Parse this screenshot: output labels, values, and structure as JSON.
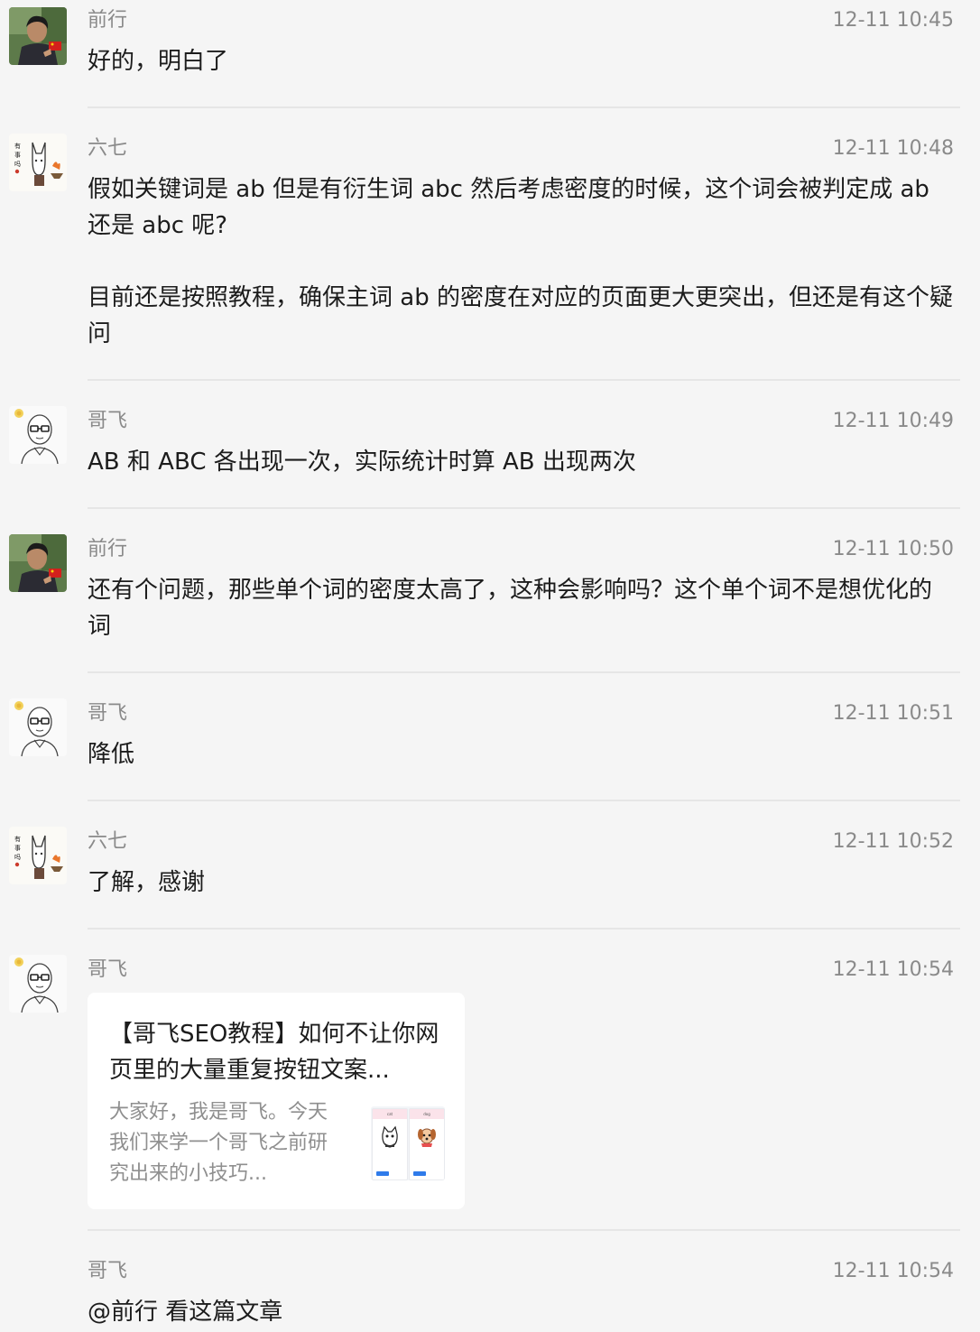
{
  "messages": [
    {
      "sender": "前行",
      "time": "12-11 10:45",
      "text": "好的，明白了",
      "avatar_icon": "qianxing-avatar-photo"
    },
    {
      "sender": "六七",
      "time": "12-11 10:48",
      "text": "假如关键词是 ab 但是有衍生词 abc 然后考虑密度的时候，这个词会被判定成 ab 还是 abc 呢?\n\n目前还是按照教程，确保主词 ab 的密度在对应的页面更大更突出，但还是有这个疑问",
      "avatar_icon": "liuqi-avatar-drawing"
    },
    {
      "sender": "哥飞",
      "time": "12-11 10:49",
      "text": "AB 和 ABC 各出现一次，实际统计时算 AB 出现两次",
      "avatar_icon": "gefei-avatar-sketch"
    },
    {
      "sender": "前行",
      "time": "12-11 10:50",
      "text": "还有个问题，那些单个词的密度太高了，这种会影响吗？这个单个词不是想优化的词",
      "avatar_icon": "qianxing-avatar-photo"
    },
    {
      "sender": "哥飞",
      "time": "12-11 10:51",
      "text": "降低",
      "avatar_icon": "gefei-avatar-sketch"
    },
    {
      "sender": "六七",
      "time": "12-11 10:52",
      "text": "了解，感谢",
      "avatar_icon": "liuqi-avatar-drawing"
    },
    {
      "sender": "哥飞",
      "time": "12-11 10:54",
      "avatar_icon": "gefei-avatar-sketch",
      "card": {
        "title": "【哥飞SEO教程】如何不让你网页里的大量重复按钮文案...",
        "description": "大家好，我是哥飞。今天我们来学一个哥飞之前研究出来的小技巧...",
        "thumbnail_icon": "cat-dog-article-thumbnail",
        "thumb_labels": [
          "cat",
          "dog"
        ]
      }
    },
    {
      "sender": "哥飞",
      "time": "12-11 10:54",
      "text": "@前行 看这篇文章"
    }
  ],
  "colors": {
    "background": "#f5f5f5",
    "meta_text": "#8a8a8a",
    "body_text": "#1c1c1c",
    "card_bg": "#ffffff",
    "divider": "#e6e6e6"
  }
}
